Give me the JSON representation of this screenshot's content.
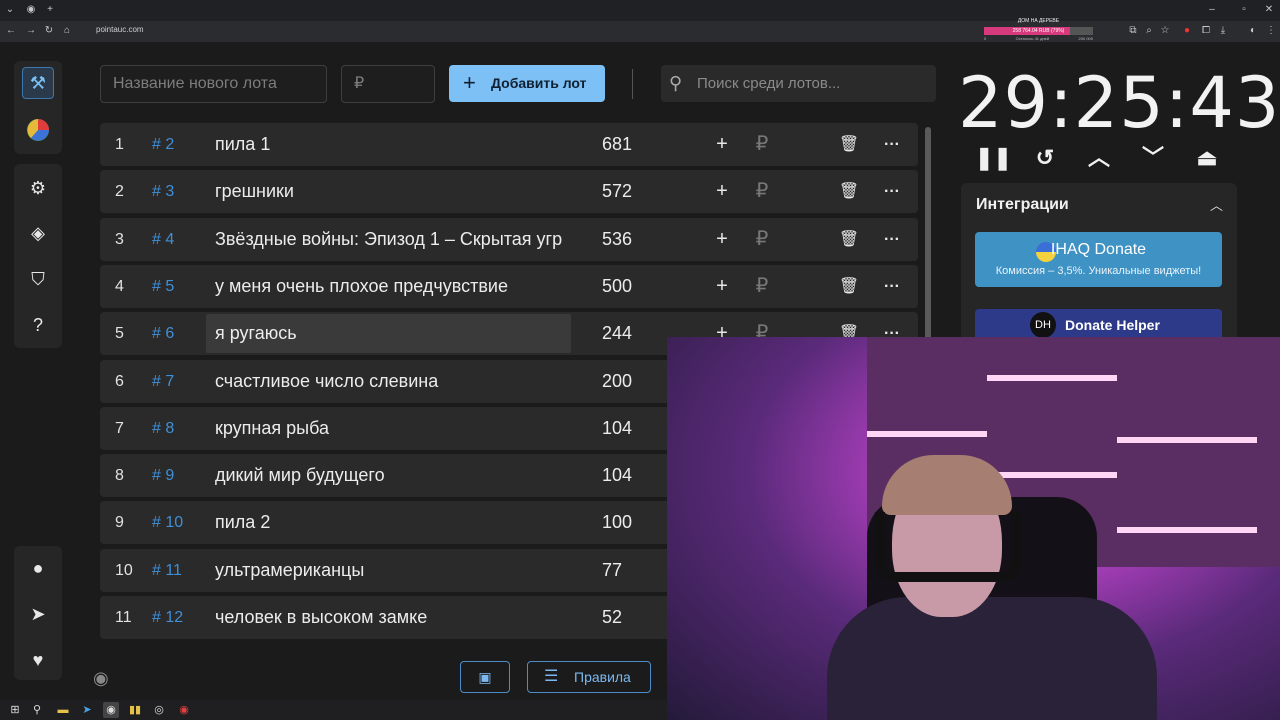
{
  "browser": {
    "url": "pointauc.com",
    "goal": {
      "title": "ДОМ НА ДЕРЕВЕ",
      "amount": "258 764.04 RUB (79%)",
      "progress": 0.79,
      "left": "Осталось 41 дней",
      "right": "200 000",
      "start": "0"
    }
  },
  "form": {
    "name_placeholder": "Название нового лота",
    "price_placeholder": "₽",
    "add_label": "Добавить лот",
    "search_placeholder": "Поиск среди лотов..."
  },
  "lots": [
    {
      "n": "1",
      "id": "# 2",
      "name": "пила 1",
      "amount": "681"
    },
    {
      "n": "2",
      "id": "# 3",
      "name": "грешники",
      "amount": "572"
    },
    {
      "n": "3",
      "id": "# 4",
      "name": "Звёздные войны: Эпизод 1 – Скрытая угр",
      "amount": "536"
    },
    {
      "n": "4",
      "id": "# 5",
      "name": "у меня очень плохое предчувствие",
      "amount": "500"
    },
    {
      "n": "5",
      "id": "# 6",
      "name": "я ругаюсь",
      "amount": "244"
    },
    {
      "n": "6",
      "id": "# 7",
      "name": "счастливое число слевина",
      "amount": "200"
    },
    {
      "n": "7",
      "id": "# 8",
      "name": "крупная рыба",
      "amount": "104"
    },
    {
      "n": "8",
      "id": "# 9",
      "name": "дикий мир будущего",
      "amount": "104"
    },
    {
      "n": "9",
      "id": "# 10",
      "name": "пила 2",
      "amount": "100"
    },
    {
      "n": "10",
      "id": "# 11",
      "name": "ультрамериканцы",
      "amount": "77"
    },
    {
      "n": "11",
      "id": "# 12",
      "name": "человек в высоком замке",
      "amount": "52"
    }
  ],
  "actions": {
    "plus": "+",
    "currency": "₽",
    "delete": "🗑",
    "more": "···"
  },
  "timer": {
    "value": "29:25:43"
  },
  "integrations": {
    "title": "Интеграции",
    "ihaq_name": "IHAQ Donate",
    "ihaq_sub": "Комиссия – 3,5%. Уникальные виджеты!",
    "dh_name": "Donate Helper",
    "dh_logo": "DH"
  },
  "bottom": {
    "rules_label": "Правила"
  },
  "icons": {
    "auction": "gavel-icon",
    "wheel": "pie-wheel-icon",
    "settings": "gear-icon",
    "layers": "layers-icon",
    "shield": "shield-check-icon",
    "help": "help-icon",
    "github": "github-icon",
    "telegram": "telegram-icon",
    "donate": "donate-hand-icon"
  }
}
